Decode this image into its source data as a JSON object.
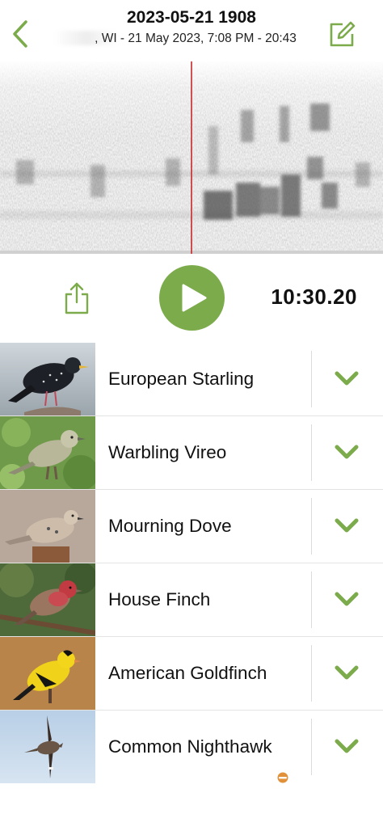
{
  "header": {
    "title": "2023-05-21 1908",
    "subtitle": ", WI - 21 May 2023, 7:08 PM - 20:43",
    "back_icon": "chevron-left-icon",
    "edit_icon": "edit-note-icon"
  },
  "player": {
    "time": "10:30.20",
    "play_icon": "play-icon",
    "share_icon": "share-icon"
  },
  "colors": {
    "accent": "#7cab4b",
    "playhead": "#c62828"
  },
  "species": [
    {
      "name": "European Starling",
      "thumb_icon": "starling-photo",
      "badge": false
    },
    {
      "name": "Warbling Vireo",
      "thumb_icon": "vireo-photo",
      "badge": false
    },
    {
      "name": "Mourning Dove",
      "thumb_icon": "dove-photo",
      "badge": false
    },
    {
      "name": "House Finch",
      "thumb_icon": "finch-photo",
      "badge": false
    },
    {
      "name": "American Goldfinch",
      "thumb_icon": "goldfinch-photo",
      "badge": false
    },
    {
      "name": "Common Nighthawk",
      "thumb_icon": "nighthawk-photo",
      "badge": true
    }
  ]
}
